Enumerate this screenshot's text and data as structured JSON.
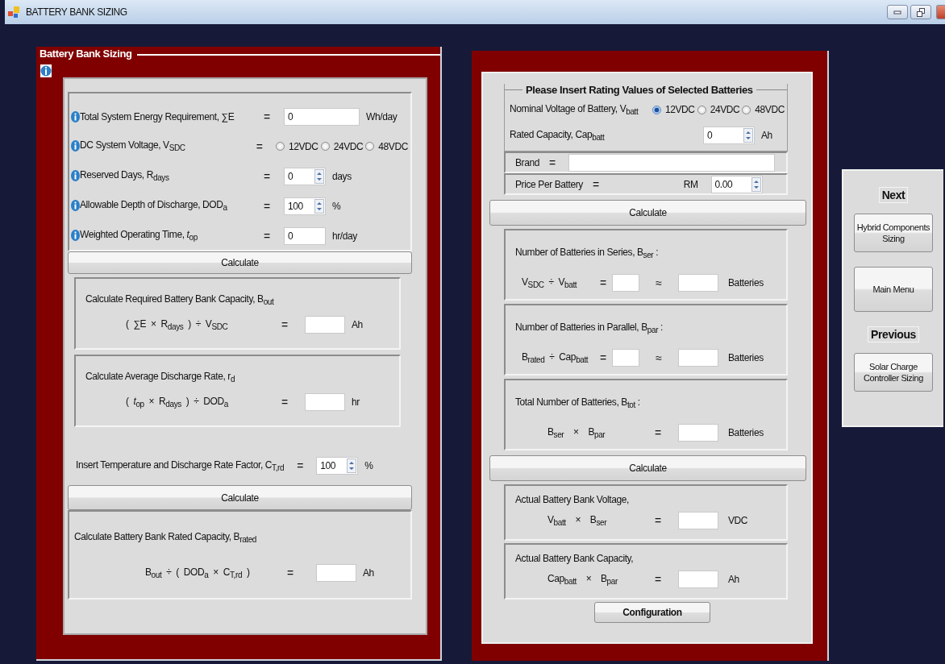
{
  "window": {
    "title": "BATTERY BANK SIZING"
  },
  "left_panel": {
    "title": "Battery Bank Sizing",
    "inputs": [
      {
        "kind": "text",
        "label": "Total System Energy Requirement, ∑E",
        "equals": "=",
        "value": "0",
        "unit": "Wh/day"
      },
      {
        "kind": "radio",
        "label": "DC System Voltage, V$_{SDC}$",
        "equals": "=",
        "options": [
          {
            "label": "12VDC",
            "selected": false
          },
          {
            "label": "24VDC",
            "selected": false
          },
          {
            "label": "48VDC",
            "selected": false
          }
        ]
      },
      {
        "kind": "spin",
        "label": "Reserved Days, R$_{days}$",
        "equals": "=",
        "value": "0",
        "unit": "days"
      },
      {
        "kind": "spin",
        "label": "Allowable Depth of Discharge, DOD$_{a}$",
        "equals": "=",
        "value": "100",
        "unit": "%"
      },
      {
        "kind": "short",
        "label": "Weighted Operating Time, *t*$_{op}$",
        "equals": "=",
        "value": "0",
        "unit": "hr/day"
      }
    ],
    "calculate_button": "Calculate",
    "results": [
      {
        "heading": "Calculate Required Battery Bank Capacity, B$_{out}$",
        "formula": "(  ∑E  ×  R$_{days}$  )  ÷  V$_{SDC}$",
        "equals": "=",
        "unit": "Ah"
      },
      {
        "heading": "Calculate Average Discharge Rate, r$_{d}$",
        "formula": "(  *t*$_{op}$  ×  R$_{days}$  )  ÷  DOD$_{a}$",
        "equals": "=",
        "unit": "hr"
      }
    ],
    "factor": {
      "label": "Insert Temperature and Discharge Rate Factor, C$_{T,rd}$",
      "equals": "=",
      "value": "100",
      "unit": "%"
    },
    "calculate_button_2": "Calculate",
    "rated": {
      "heading": "Calculate Battery Bank Rated Capacity, B$_{rated}$",
      "formula": "B$_{out}$  ÷  (  DOD$_{a}$  ×  C$_{T,rd}$  )",
      "equals": "=",
      "unit": "Ah"
    }
  },
  "right_panel": {
    "rating_group": {
      "title": "Please Insert Rating Values of Selected Batteries",
      "voltage": {
        "label": "Nominal Voltage of Battery, V$_{batt}$",
        "options": [
          {
            "label": "12VDC",
            "selected": true
          },
          {
            "label": "24VDC",
            "selected": false
          },
          {
            "label": "48VDC",
            "selected": false
          }
        ]
      },
      "capacity": {
        "label": "Rated Capacity, Cap$_{batt}$",
        "value": "0",
        "unit": "Ah"
      }
    },
    "brand": {
      "label": "Brand",
      "equals": "="
    },
    "price": {
      "label": "Price Per Battery",
      "equals": "=",
      "currency": "RM",
      "value": "0.00"
    },
    "calculate_button": "Calculate",
    "counts": [
      {
        "kind": "approx",
        "heading": "Number of Batteries in Series,  B$_{ser}$  :",
        "formula": "V$_{SDC}$  ÷  V$_{batt}$",
        "equals": "=",
        "approx": "≈",
        "unit": "Batteries"
      },
      {
        "kind": "approx",
        "heading": "Number of Batteries in Parallel, B$_{par}$  :",
        "formula": "B$_{rated}$  ÷  Cap$_{batt}$",
        "equals": "=",
        "approx": "≈",
        "unit": "Batteries"
      },
      {
        "kind": "direct",
        "heading": "Total Number of Batteries,  B$_{tot}$  :",
        "formula": "B$_{ser}$    ×    B$_{par}$",
        "equals": "=",
        "unit": "Batteries"
      }
    ],
    "calculate_button_2": "Calculate",
    "actuals": [
      {
        "heading": "Actual Battery Bank Voltage,",
        "formula": "V$_{batt}$    ×    B$_{ser}$",
        "equals": "=",
        "unit": "VDC"
      },
      {
        "heading": "Actual Battery Bank Capacity,",
        "formula": "Cap$_{batt}$    ×    B$_{par}$",
        "equals": "=",
        "unit": "Ah"
      }
    ],
    "configuration_button": "Configuration"
  },
  "navigation": {
    "next_label": "Next",
    "next_button": "Hybrid Components Sizing",
    "main_menu_button": "Main Menu",
    "previous_label": "Previous",
    "previous_button": "Solar Charge Controller Sizing"
  }
}
